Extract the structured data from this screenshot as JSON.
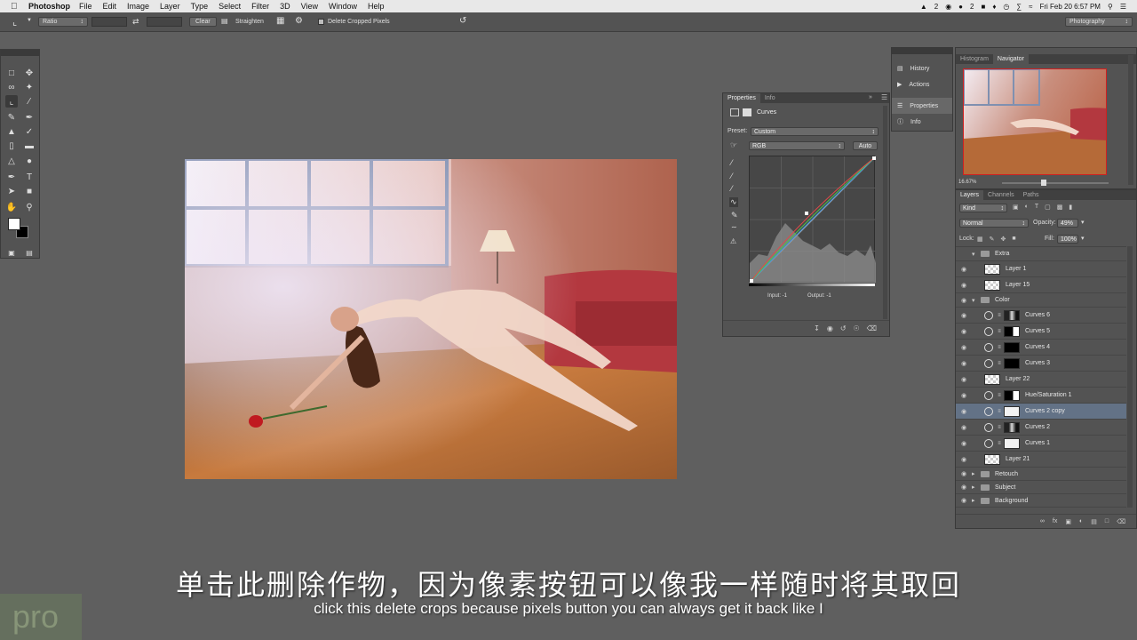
{
  "menubar": {
    "app_name": "Photoshop",
    "items": [
      "File",
      "Edit",
      "Image",
      "Layer",
      "Type",
      "Select",
      "Filter",
      "3D",
      "View",
      "Window",
      "Help"
    ],
    "status": {
      "adobe_count": "2",
      "cc_count": "2",
      "clock": "Fri Feb 20  6:57 PM"
    }
  },
  "optionsbar": {
    "ratio_label": "Ratio",
    "clear_label": "Clear",
    "straighten_label": "Straighten",
    "delete_cropped_label": "Delete Cropped Pixels",
    "workspace": "Photography"
  },
  "properties": {
    "tabs": [
      "Properties",
      "Info"
    ],
    "title": "Curves",
    "preset_label": "Preset:",
    "preset_value": "Custom",
    "channel_value": "RGB",
    "auto_label": "Auto",
    "input_label": "Input: -1",
    "output_label": "Output: -1"
  },
  "dock": {
    "items": [
      "History",
      "Actions",
      "Properties",
      "Info"
    ]
  },
  "navigator": {
    "tabs": [
      "Histogram",
      "Navigator"
    ],
    "zoom": "16.67%"
  },
  "layers": {
    "tabs": [
      "Layers",
      "Channels",
      "Paths"
    ],
    "filter_kind": "Kind",
    "blend_mode": "Normal",
    "opacity_label": "Opacity:",
    "opacity_value": "49%",
    "lock_label": "Lock:",
    "fill_label": "Fill:",
    "fill_value": "100%",
    "rows": [
      {
        "name": "Extra",
        "kind": "group-open"
      },
      {
        "name": "Layer 1",
        "kind": "layer"
      },
      {
        "name": "Layer 15",
        "kind": "layer"
      },
      {
        "name": "Color",
        "kind": "group-open"
      },
      {
        "name": "Curves 6",
        "kind": "adjust",
        "mask": "mixed"
      },
      {
        "name": "Curves 5",
        "kind": "adjust",
        "mask": "dark"
      },
      {
        "name": "Curves 4",
        "kind": "adjust",
        "mask": "black"
      },
      {
        "name": "Curves 3",
        "kind": "adjust",
        "mask": "black"
      },
      {
        "name": "Layer 22",
        "kind": "layer"
      },
      {
        "name": "Hue/Saturation 1",
        "kind": "adjust",
        "mask": "dark"
      },
      {
        "name": "Curves 2 copy",
        "kind": "adjust",
        "mask": "white",
        "selected": true
      },
      {
        "name": "Curves 2",
        "kind": "adjust",
        "mask": "mixed"
      },
      {
        "name": "Curves 1",
        "kind": "adjust",
        "mask": "white"
      },
      {
        "name": "Layer 21",
        "kind": "layer"
      },
      {
        "name": "Retouch",
        "kind": "group"
      },
      {
        "name": "Subject",
        "kind": "group"
      },
      {
        "name": "Background",
        "kind": "group"
      }
    ]
  },
  "subtitles": {
    "zh": "单击此删除作物，因为像素按钮可以像我一样随时将其取回",
    "en": "click this delete crops because pixels button you can always get it back like I"
  },
  "watermark": "pro"
}
